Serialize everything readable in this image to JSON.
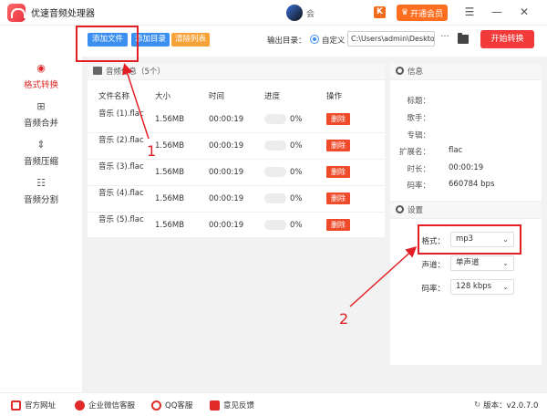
{
  "app": {
    "title": "优速音频处理器",
    "user_name": "会"
  },
  "titlebar": {
    "vip_label": "开通会员",
    "vip_icon_letter": "K",
    "minimize": "—",
    "close": "✕",
    "menu": "☰"
  },
  "sidebar": {
    "items": [
      {
        "label": "格式转换",
        "icon": "audio-convert-icon",
        "active": true
      },
      {
        "label": "音频合并",
        "icon": "merge-icon"
      },
      {
        "label": "音频压缩",
        "icon": "compress-icon"
      },
      {
        "label": "音频分割",
        "icon": "split-icon"
      }
    ]
  },
  "toolbar": {
    "add_file": "添加文件",
    "add_dir": "添加目录",
    "clear_list": "清除列表",
    "output_label": "输出目录：",
    "radio_label": "自定义",
    "output_path": "C:\\Users\\admin\\Deskto",
    "more": "···",
    "start": "开始转换"
  },
  "files": {
    "header": "音频信息（5个）",
    "columns": [
      "文件名称",
      "大小",
      "时间",
      "进度",
      "操作"
    ],
    "rows": [
      {
        "name": "音乐 (1).flac",
        "size": "1.56MB",
        "time": "00:00:19",
        "progress": "0%",
        "action": "删除"
      },
      {
        "name": "音乐 (2).flac",
        "size": "1.56MB",
        "time": "00:00:19",
        "progress": "0%",
        "action": "删除"
      },
      {
        "name": "音乐 (3).flac",
        "size": "1.56MB",
        "time": "00:00:19",
        "progress": "0%",
        "action": "删除"
      },
      {
        "name": "音乐 (4).flac",
        "size": "1.56MB",
        "time": "00:00:19",
        "progress": "0%",
        "action": "删除"
      },
      {
        "name": "音乐 (5).flac",
        "size": "1.56MB",
        "time": "00:00:19",
        "progress": "0%",
        "action": "删除"
      }
    ]
  },
  "info": {
    "header": "信息",
    "rows": [
      {
        "label": "标题：",
        "value": ""
      },
      {
        "label": "歌手：",
        "value": ""
      },
      {
        "label": "专辑：",
        "value": ""
      },
      {
        "label": "扩展名：",
        "value": "flac"
      },
      {
        "label": "时长：",
        "value": "00:00:19"
      },
      {
        "label": "码率：",
        "value": "660784 bps"
      }
    ]
  },
  "settings": {
    "header": "设置",
    "format_label": "格式：",
    "format_value": "mp3",
    "channel_label": "声道：",
    "channel_value": "单声道",
    "bitrate_label": "码率：",
    "bitrate_value": "128 kbps"
  },
  "annotations": {
    "one": "1",
    "two": "2",
    "color": "#e31e24"
  },
  "footer": {
    "website": "官方网址",
    "wechat": "企业微信客服",
    "qq": "QQ客服",
    "feedback": "意见反馈",
    "version": "版本：v2.0.7.0"
  }
}
